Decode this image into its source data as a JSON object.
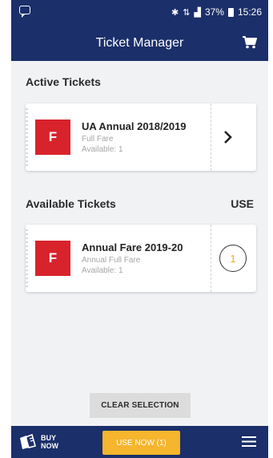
{
  "status_bar": {
    "battery": "37%",
    "time": "15:26"
  },
  "header": {
    "title": "Ticket Manager",
    "cart_icon": "shopping-cart-icon"
  },
  "active_section": {
    "title": "Active Tickets",
    "tickets": [
      {
        "badge": "F",
        "name": "UA Annual 2018/2019",
        "type": "Full Fare",
        "available": "Available: 1",
        "action_icon": "chevron-right-icon"
      }
    ]
  },
  "available_section": {
    "title": "Available Tickets",
    "use_header": "USE",
    "tickets": [
      {
        "badge": "F",
        "name": "Annual Fare 2019-20",
        "type": "Annual Full Fare",
        "available": "Available: 1",
        "use_count": "1"
      }
    ]
  },
  "clear_button": "CLEAR SELECTION",
  "bottom_bar": {
    "buy_label": "BUY NOW",
    "use_now_label": "USE NOW (1)",
    "menu_icon": "hamburger-menu-icon"
  },
  "colors": {
    "brand_navy": "#1b2f6a",
    "badge_red": "#d8232c",
    "accent_yellow": "#f5b52c",
    "background": "#f1f2f4"
  }
}
